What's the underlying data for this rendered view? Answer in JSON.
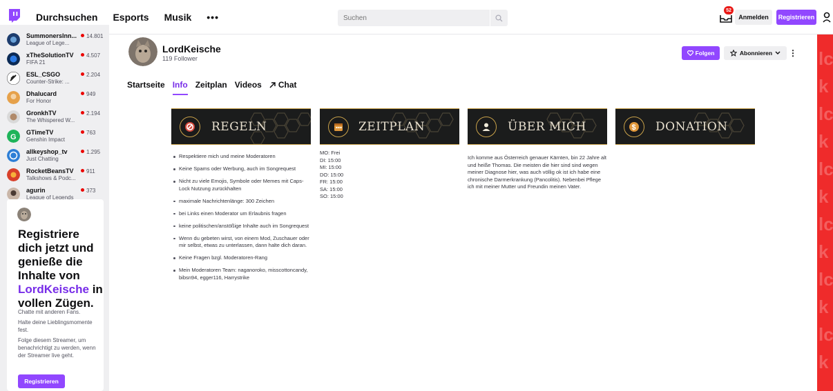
{
  "nav": {
    "links": [
      "Durchsuchen",
      "Esports",
      "Musik"
    ],
    "more": "•••",
    "search_placeholder": "Suchen",
    "inbox_count": "52",
    "login": "Anmelden",
    "register": "Registrieren"
  },
  "sidebar": {
    "channels": [
      {
        "name": "SummonersInn...",
        "game": "League of Lege...",
        "viewers": "14.801"
      },
      {
        "name": "xTheSolutionTV",
        "game": "FIFA 21",
        "viewers": "4.507"
      },
      {
        "name": "ESL_CSGO",
        "game": "Counter-Strike: ...",
        "viewers": "2.204"
      },
      {
        "name": "Dhalucard",
        "game": "For Honor",
        "viewers": "949"
      },
      {
        "name": "GronkhTV",
        "game": "The Whispered W...",
        "viewers": "2.194"
      },
      {
        "name": "GTimeTV",
        "game": "Genshin Impact",
        "viewers": "763"
      },
      {
        "name": "allkeyshop_tv",
        "game": "Just Chatting",
        "viewers": "1.295"
      },
      {
        "name": "RocketBeansTV",
        "game": "Talkshows & Podc...",
        "viewers": "911"
      },
      {
        "name": "agurin",
        "game": "League of Legends",
        "viewers": "373"
      }
    ],
    "promo": {
      "title_pre": "Registriere dich jetzt und genieße die Inhalte von ",
      "title_channel": "LordKeische",
      "title_post": " in vollen Zügen.",
      "line1": "Chatte mit anderen Fans.",
      "line2": "Halte deine Lieblingsmomente fest.",
      "line3": "Folge diesem Streamer, um benachrichtigt zu werden, wenn der Streamer live geht.",
      "button": "Registrieren"
    }
  },
  "channel": {
    "name": "LordKeische",
    "followers": "119 Follower",
    "follow_button": "Folgen",
    "subscribe_button": "Abonnieren",
    "more": "⋮"
  },
  "tabs": [
    "Startseite",
    "Info",
    "Zeitplan",
    "Videos",
    "Chat"
  ],
  "active_tab": "Info",
  "panels": {
    "rules_title": "REGELN",
    "schedule_title": "ZEITPLAN",
    "about_title": "ÜBER MICH",
    "donation_title": "DONATION",
    "rules": [
      "Respektiere mich und meine Moderatoren",
      "Keine Spams oder Werbung, auch im Songrequest",
      "Nicht zu viele Emojis, Symbole oder Memes mit Caps-Lock Nutzung zurückhalten",
      "maximale Nachrichtenlänge: 300 Zeichen",
      "bei Links einen Moderator um Erlaubnis fragen",
      "keine politischen/anstößige Inhalte auch im Songrequest",
      "Wenn du gebeten wirst, von einem Mod, Zuschauer oder mir selbst, etwas zu unterlassen, dann halte dich daran.",
      "Keine Fragen bzgl. Moderatoren-Rang",
      "Mein Moderatoren Team: naganoroko, misscottoncandy, bibsn94, egger116, Harrystrike"
    ],
    "schedule": [
      "MO: Frei",
      "DI: 15:00",
      "MI: 15:00",
      "DO: 15:00",
      "FR: 15:00",
      "SA: 15:00",
      "SO: 15:00"
    ],
    "about": "Ich komme aus Österreich genauer Kärnten, bin 22 Jahre alt und heiße Thomas. Die meisten die hier sind sind wegen meiner Diagnose hier, was auch völlig ok ist ich habe eine chronische Darmerkrankung (Pancolitis). Nebenbei Pflege ich mit meiner Mutter und Freundin meinen Vater."
  },
  "colors": {
    "accent": "#9147ff",
    "accent_text": "#772ce8",
    "live": "#eb0400",
    "panel_gold": "#c9a24a",
    "red_strip": "#ef2b2b"
  }
}
